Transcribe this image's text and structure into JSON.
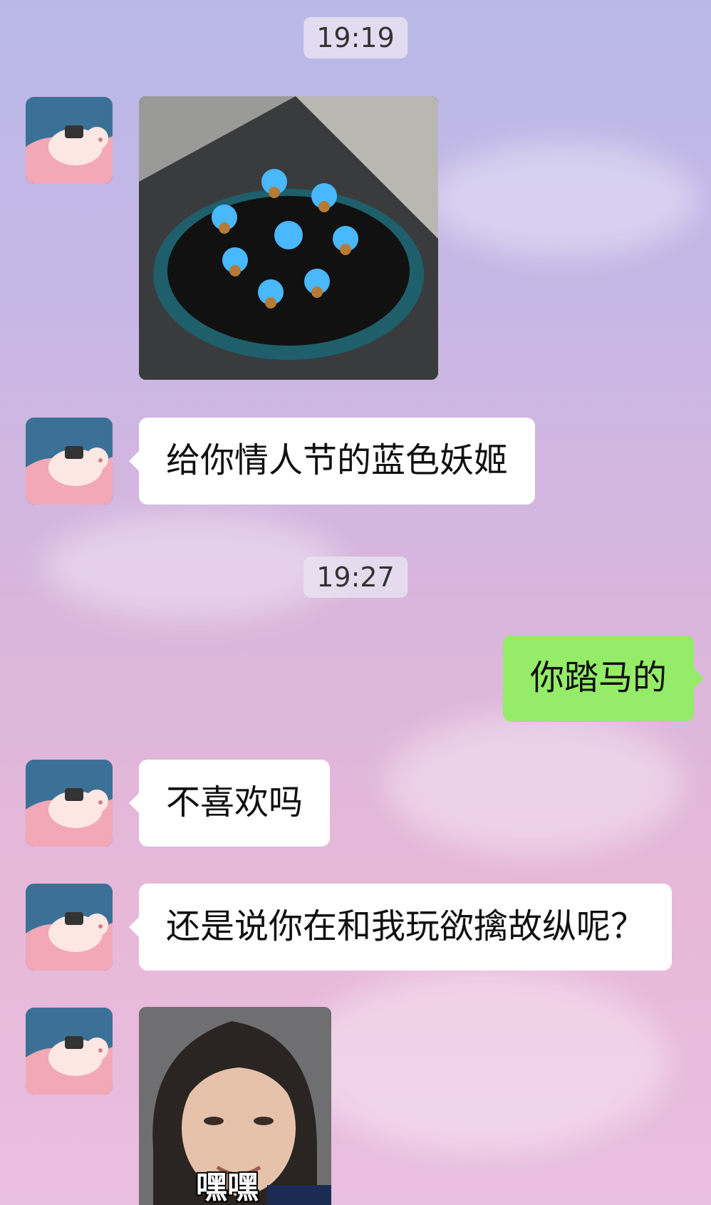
{
  "timestamps": [
    "19:19",
    "19:27"
  ],
  "messages": [
    {
      "type": "image",
      "side": "left",
      "alt": "gas-stove-blue-flames"
    },
    {
      "type": "text",
      "side": "left",
      "text": "给你情人节的蓝色妖姬"
    },
    {
      "type": "text",
      "side": "right",
      "text": "你踏马的"
    },
    {
      "type": "text",
      "side": "left",
      "text": "不喜欢吗"
    },
    {
      "type": "text",
      "side": "left",
      "text": "还是说你在和我玩欲擒故纵呢？"
    },
    {
      "type": "image",
      "side": "left",
      "alt": "smirking-meme",
      "caption": "嘿嘿"
    }
  ],
  "colors": {
    "self_bubble": "#95ec69",
    "other_bubble": "#ffffff",
    "timestamp_bg": "#e8e2f0"
  }
}
